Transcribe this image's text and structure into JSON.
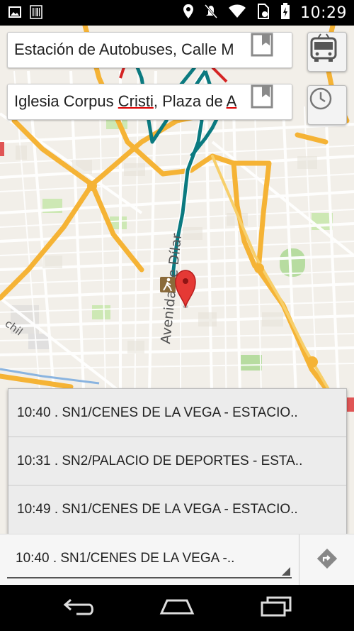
{
  "status_bar": {
    "time": "10:29",
    "icons_left": [
      "image-icon",
      "barcode-icon"
    ],
    "icons_right": [
      "location-icon",
      "mute-icon",
      "wifi-icon",
      "sim-icon",
      "battery-icon"
    ]
  },
  "origin": {
    "value": "Estación de Autobuses, Calle M",
    "bookmark_icon": "bookmark-icon"
  },
  "destination": {
    "value_prefix": "Iglesia Corpus ",
    "value_misspelled": "Cristi",
    "value_suffix": ", Plaza de ",
    "value_cut": "A"
  },
  "side_buttons": {
    "transport": "bus-icon",
    "time": "clock-icon"
  },
  "map": {
    "street_label": "Avenida de Dílar",
    "partial_label": "chil",
    "route_color": "#0b7a80",
    "major_road_color": "#f5b335",
    "marker_color": "#e53935"
  },
  "results": [
    {
      "label": "10:40 . SN1/CENES DE LA VEGA - ESTACIO.."
    },
    {
      "label": "10:31 . SN2/PALACIO DE DEPORTES - ESTA.."
    },
    {
      "label": "10:49 . SN1/CENES DE LA VEGA - ESTACIO.."
    }
  ],
  "selector": {
    "value": "10:40 . SN1/CENES DE LA VEGA -.."
  },
  "nav": {
    "back": "back-icon",
    "home": "home-icon",
    "recents": "recents-icon"
  }
}
